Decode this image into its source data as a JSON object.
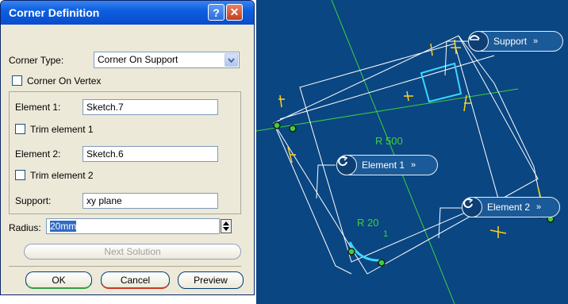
{
  "dialog": {
    "title": "Corner Definition",
    "help_label": "?",
    "close_label": "✕",
    "corner_type_label": "Corner Type:",
    "corner_type_value": "Corner On Support",
    "corner_on_vertex_label": "Corner On Vertex",
    "element1_label": "Element 1:",
    "element1_value": "Sketch.7",
    "trim1_label": "Trim element 1",
    "element2_label": "Element 2:",
    "element2_value": "Sketch.6",
    "trim2_label": "Trim element 2",
    "support_label": "Support:",
    "support_value": "xy plane",
    "radius_label": "Radius:",
    "radius_value": "20mm",
    "next_solution_label": "Next Solution",
    "ok_label": "OK",
    "cancel_label": "Cancel",
    "preview_label": "Preview"
  },
  "viewport": {
    "support_callout": "Support",
    "element1_callout": "Element 1",
    "element2_callout": "Element 2",
    "callout_arrows": "»",
    "radius_large": "R 500",
    "radius_small": "R 20",
    "radius_small_tag": "1",
    "colors": {
      "background": "#0a4682",
      "wire": "#ffffff",
      "guide": "#3ecf3e",
      "constraint": "#ffd21e",
      "highlight": "#3ad7ff"
    }
  }
}
